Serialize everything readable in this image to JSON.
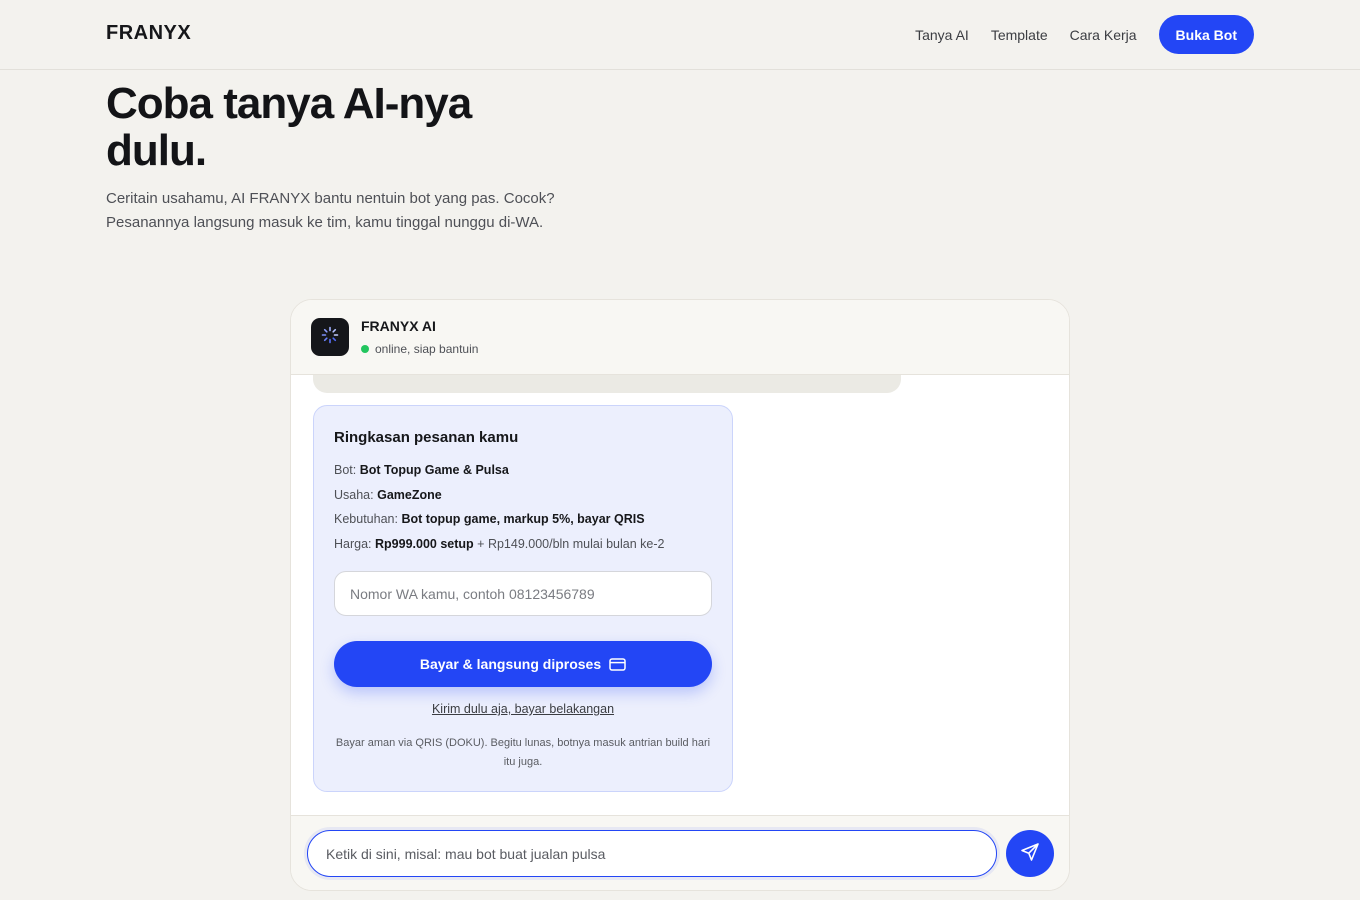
{
  "header": {
    "brand": "FRANYX",
    "nav": [
      "Tanya AI",
      "Template",
      "Cara Kerja"
    ],
    "cta": "Buka Bot"
  },
  "hero": {
    "title": "Coba tanya AI-nya dulu.",
    "description": "Ceritain usahamu, AI FRANYX bantu nentuin bot yang pas. Cocok? Pesanannya langsung masuk ke tim, kamu tinggal nunggu di-WA."
  },
  "chat": {
    "name": "FRANYX AI",
    "status": "online, siap bantuin",
    "order": {
      "title": "Ringkasan pesanan kamu",
      "rows": [
        {
          "label": "Bot:",
          "value": "Bot Topup Game & Pulsa",
          "extra": ""
        },
        {
          "label": "Usaha:",
          "value": "GameZone",
          "extra": ""
        },
        {
          "label": "Kebutuhan:",
          "value": "Bot topup game, markup 5%, bayar QRIS",
          "extra": ""
        },
        {
          "label": "Harga:",
          "value": "Rp999.000 setup",
          "extra": "+ Rp149.000/bln mulai bulan ke-2"
        }
      ],
      "wa_placeholder": "Nomor WA kamu, contoh 08123456789",
      "pay_button": "Bayar & langsung diproses",
      "later_link": "Kirim dulu aja, bayar belakangan",
      "note": "Bayar aman via QRIS (DOKU). Begitu lunas, botnya masuk antrian build hari itu juga."
    },
    "input_placeholder": "Ketik di sini, misal: mau bot buat jualan pulsa"
  },
  "colors": {
    "accent": "#2346f5",
    "background": "#f3f2ee",
    "status_online": "#22c55e"
  },
  "icons": [
    "spinner-icon",
    "card-icon",
    "send-icon"
  ]
}
